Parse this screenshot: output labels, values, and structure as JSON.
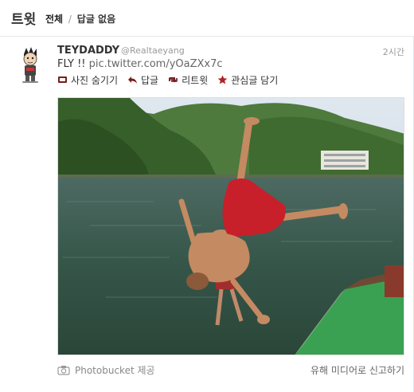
{
  "header": {
    "title": "트윗",
    "filter_all": "전체",
    "filter_sep": "/",
    "filter_no_replies": "답글 없음"
  },
  "tweet": {
    "name": "TEYDADDY",
    "handle": "@Realtaeyang",
    "time": "2시간",
    "text_prefix": "FLY !! ",
    "text_link": "pic.twitter.com/yOaZXx7c",
    "actions": {
      "hide_photo": "사진 숨기기",
      "reply": "답글",
      "retweet": "리트윗",
      "favorite": "관심글 담기"
    },
    "media_alt": "",
    "footer": {
      "provider": "Photobucket 제공",
      "report": "유해 미디어로 신고하기"
    }
  },
  "icons": {
    "hide_photo": "photo-icon",
    "reply": "reply-arrow-icon",
    "retweet": "retweet-icon",
    "favorite": "star-icon",
    "provider": "camera-icon"
  },
  "colors": {
    "action_icon": "#7a1c1c",
    "star": "#b22222",
    "muted": "#999999"
  }
}
